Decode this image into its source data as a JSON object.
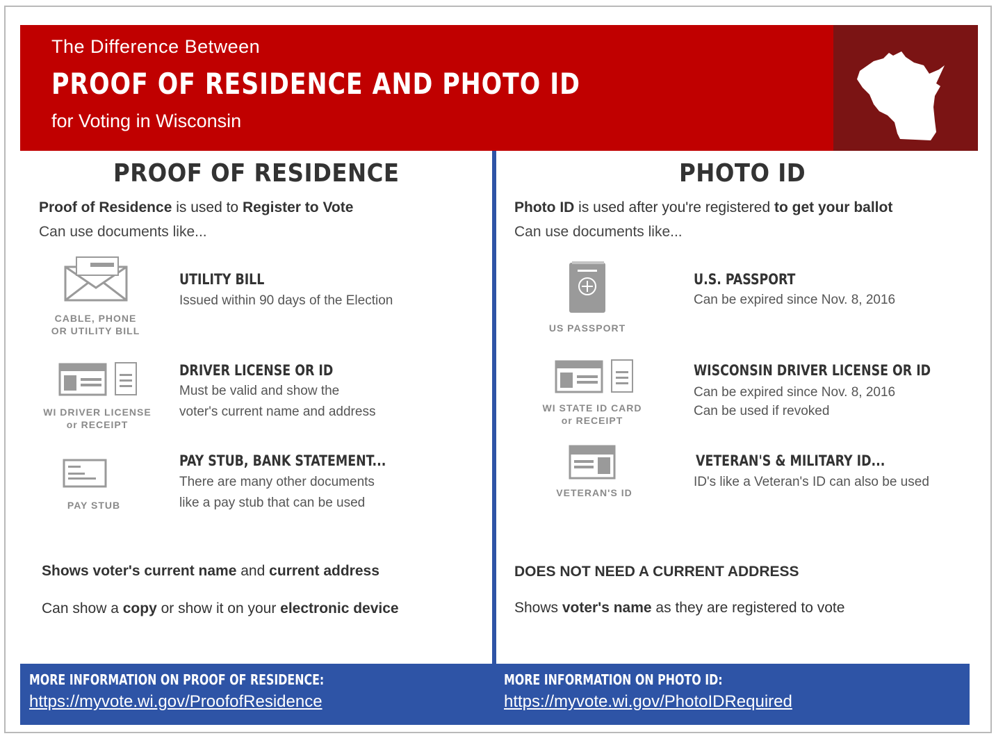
{
  "header": {
    "line1": "The Difference Between",
    "title": "PROOF OF RESIDENCE AND PHOTO ID",
    "line2": "for Voting in Wisconsin",
    "map_icon": "wisconsin-map-icon"
  },
  "residence": {
    "heading": "PROOF OF RESIDENCE",
    "lead_bold1": "Proof of Residence",
    "lead_mid": " is used to ",
    "lead_bold2": "Register to Vote",
    "sublead": "Can use documents like...",
    "items": [
      {
        "icon": "envelope-icon",
        "caption1": "CABLE, PHONE",
        "caption2": "OR UTILITY BILL",
        "title": "UTILITY BILL",
        "desc1": "Issued within 90 days of the Election",
        "desc2": ""
      },
      {
        "icon": "id-card-icon",
        "caption1": "WI DRIVER LICENSE",
        "caption2": "or RECEIPT",
        "title": "DRIVER LICENSE OR ID",
        "desc1": "Must be valid and show the",
        "desc2": "voter's current name and address"
      },
      {
        "icon": "pay-stub-icon",
        "caption1": "PAY STUB",
        "caption2": "",
        "title": "PAY STUB, BANK STATEMENT...",
        "desc1": "There are many other documents",
        "desc2": "like a pay stub that can be used"
      }
    ],
    "bottom1_b1": "Shows voter's current name",
    "bottom1_mid": " and ",
    "bottom1_b2": "current address",
    "bottom2_pre": "Can show a ",
    "bottom2_b1": "copy",
    "bottom2_mid": " or show it on your ",
    "bottom2_b2": "electronic device"
  },
  "photo": {
    "heading": "PHOTO ID",
    "lead_bold1": "Photo ID",
    "lead_mid": " is used after you're registered ",
    "lead_bold2": "to get your ballot",
    "sublead": "Can use documents like...",
    "items": [
      {
        "icon": "passport-icon",
        "caption1": "US PASSPORT",
        "caption2": "",
        "title": "U.S. PASSPORT",
        "desc1": "Can be expired since Nov. 8, 2016",
        "desc2": ""
      },
      {
        "icon": "id-card-icon",
        "caption1": "WI STATE ID CARD",
        "caption2": "or RECEIPT",
        "title": "WISCONSIN DRIVER LICENSE OR ID",
        "desc1": "Can be expired since Nov. 8, 2016",
        "desc2": "Can be used if revoked"
      },
      {
        "icon": "veteran-id-icon",
        "caption1": "VETERAN'S ID",
        "caption2": "",
        "title": "VETERAN'S & MILITARY ID...",
        "desc1": "ID's like a Veteran's ID can also be used",
        "desc2": ""
      }
    ],
    "bottom1": "DOES NOT NEED A CURRENT ADDRESS",
    "bottom2_pre": "Shows ",
    "bottom2_b1": "voter's name",
    "bottom2_post": " as they are registered to vote"
  },
  "footer": {
    "residence_label": "MORE INFORMATION ON PROOF OF RESIDENCE:",
    "residence_link": "https://myvote.wi.gov/ProofofResidence",
    "photo_label": "MORE INFORMATION ON PHOTO ID:",
    "photo_link": "https://myvote.wi.gov/PhotoIDRequired"
  },
  "colors": {
    "red": "#c00000",
    "dark_red": "#7b1414",
    "blue": "#2e54a6"
  }
}
